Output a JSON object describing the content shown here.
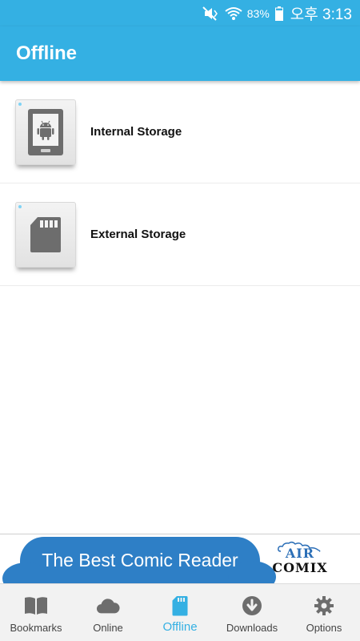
{
  "status_bar": {
    "battery_percent": "83%",
    "time": "오후 3:13",
    "icons": [
      "mute-icon",
      "wifi-icon",
      "battery-icon"
    ]
  },
  "app_bar": {
    "title": "Offline"
  },
  "storage_list": [
    {
      "label": "Internal Storage",
      "icon": "android-phone-icon"
    },
    {
      "label": "External Storage",
      "icon": "sd-card-icon"
    }
  ],
  "ad_banner": {
    "text": "The Best Comic Reader",
    "logo_top": "AIR",
    "logo_bottom": "COMIX"
  },
  "bottom_nav": {
    "active": "Offline",
    "items": [
      {
        "label": "Bookmarks",
        "icon": "book-icon"
      },
      {
        "label": "Online",
        "icon": "cloud-icon"
      },
      {
        "label": "Offline",
        "icon": "sd-card-icon"
      },
      {
        "label": "Downloads",
        "icon": "download-icon"
      },
      {
        "label": "Options",
        "icon": "gear-icon"
      }
    ]
  },
  "colors": {
    "primary": "#34b0e3",
    "icon_gray": "#6d6d6d",
    "ad_blue": "#2e7fc6"
  }
}
